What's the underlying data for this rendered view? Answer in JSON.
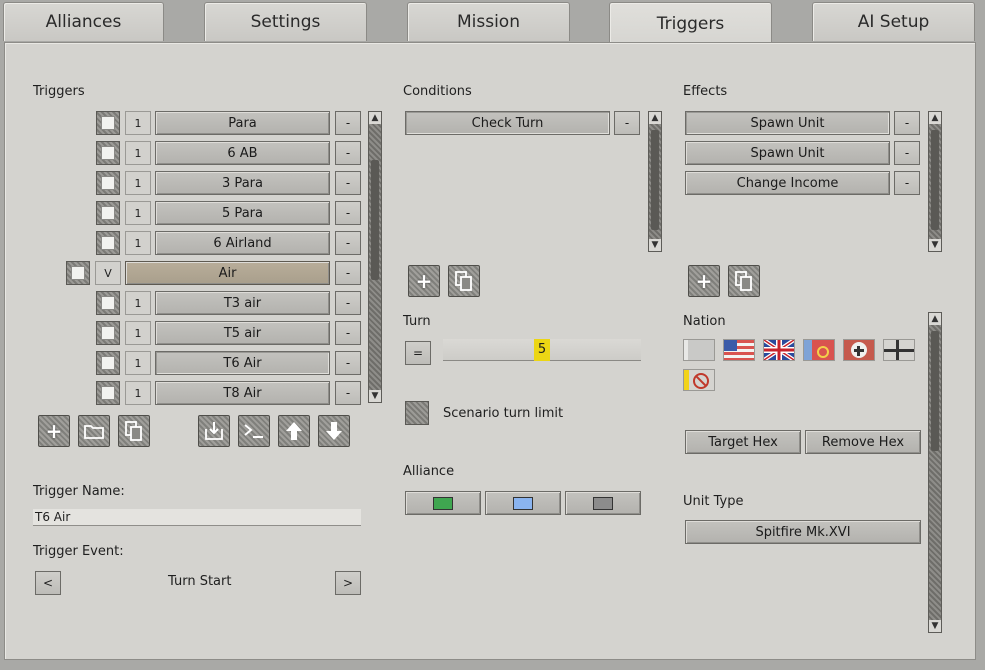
{
  "tabs": [
    "Alliances",
    "Settings",
    "Mission",
    "Triggers",
    "AI Setup"
  ],
  "triggers": {
    "label": "Triggers",
    "rows": [
      {
        "num": "1",
        "name": "Para",
        "del": "-"
      },
      {
        "num": "1",
        "name": "6 AB",
        "del": "-"
      },
      {
        "num": "1",
        "name": "3 Para",
        "del": "-"
      },
      {
        "num": "1",
        "name": "5 Para",
        "del": "-"
      },
      {
        "num": "1",
        "name": "6 Airland",
        "del": "-"
      },
      {
        "num": "V",
        "name": "Air",
        "del": "-"
      },
      {
        "num": "1",
        "name": "T3 air",
        "del": "-"
      },
      {
        "num": "1",
        "name": "T5 air",
        "del": "-"
      },
      {
        "num": "1",
        "name": "T6 Air",
        "del": "-"
      },
      {
        "num": "1",
        "name": "T8 Air",
        "del": "-"
      }
    ],
    "name_label": "Trigger Name:",
    "name_value": "T6 Air",
    "event_label": "Trigger Event:",
    "event_value": "Turn Start",
    "prev": "<",
    "next": ">"
  },
  "conditions": {
    "label": "Conditions",
    "items": [
      {
        "name": "Check Turn",
        "del": "-"
      }
    ],
    "turn_label": "Turn",
    "turn_op": "=",
    "turn_value": "5",
    "scenario_limit_label": "Scenario turn limit",
    "alliance_label": "Alliance",
    "alliance_colors": [
      "#3fa650",
      "#8ab4f0",
      "#8c8c8c"
    ]
  },
  "effects": {
    "label": "Effects",
    "items": [
      {
        "name": "Spawn Unit",
        "del": "-"
      },
      {
        "name": "Spawn Unit",
        "del": "-"
      },
      {
        "name": "Change Income",
        "del": "-"
      }
    ],
    "nation_label": "Nation",
    "target_hex": "Target Hex",
    "remove_hex": "Remove Hex",
    "unit_type_label": "Unit Type",
    "unit_type_value": "Spitfire Mk.XVI"
  }
}
